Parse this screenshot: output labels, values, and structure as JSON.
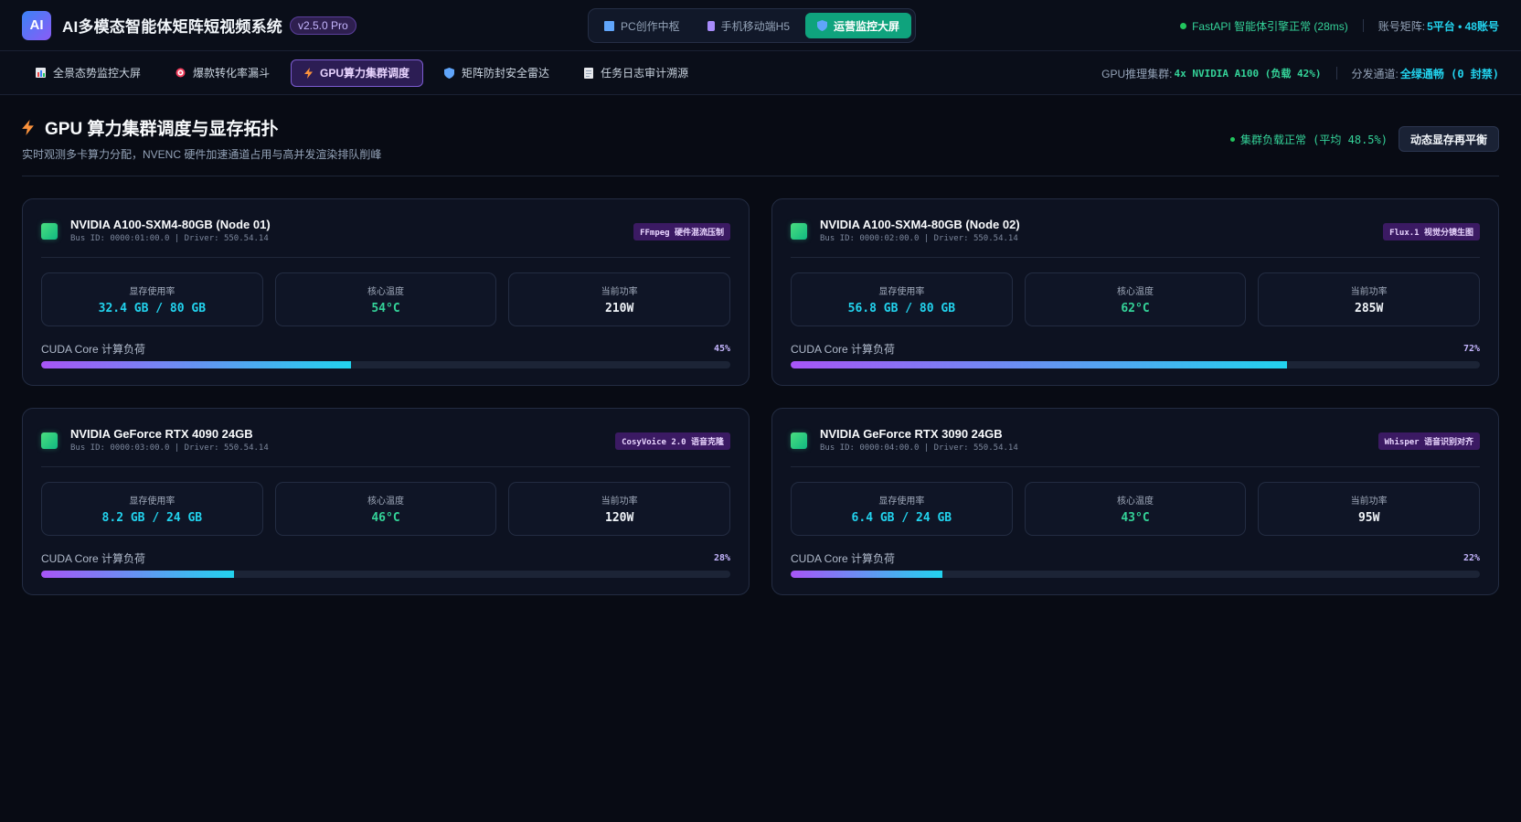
{
  "header": {
    "logo_text": "AI",
    "title": "AI多模态智能体矩阵短视频系统",
    "version": "v2.5.0 Pro",
    "modes": [
      {
        "label": "PC创作中枢",
        "icon": "monitor-icon"
      },
      {
        "label": "手机移动端H5",
        "icon": "phone-icon"
      },
      {
        "label": "运营监控大屏",
        "icon": "shield-icon",
        "active": true
      }
    ],
    "engine_status": "FastAPI 智能体引擎正常 (28ms)",
    "account_label": "账号矩阵:",
    "account_value": "5平台 • 48账号"
  },
  "subnav": {
    "tabs": [
      {
        "label": "全景态势监控大屏",
        "icon": "bar-chart-icon"
      },
      {
        "label": "爆款转化率漏斗",
        "icon": "target-icon"
      },
      {
        "label": "GPU算力集群调度",
        "icon": "lightning-icon",
        "active": true
      },
      {
        "label": "矩阵防封安全雷达",
        "icon": "shield-icon"
      },
      {
        "label": "任务日志审计溯源",
        "icon": "document-icon"
      }
    ],
    "gpu_label": "GPU推理集群:",
    "gpu_value": "4x NVIDIA A100 (负载 42%)",
    "dist_label": "分发通道:",
    "dist_value": "全绿通畅 (0 封禁)"
  },
  "page": {
    "title": "GPU 算力集群调度与显存拓扑",
    "subtitle": "实时观测多卡算力分配，NVENC 硬件加速通道占用与高并发渲染排队削峰",
    "cluster_status": "集群负载正常 (平均 48.5%)",
    "rebalance_label": "动态显存再平衡"
  },
  "labels": {
    "vram": "显存使用率",
    "temp": "核心温度",
    "power": "当前功率",
    "load": "CUDA Core 计算负荷"
  },
  "gpus": [
    {
      "name": "NVIDIA A100-SXM4-80GB (Node 01)",
      "bus": "Bus ID: 0000:01:00.0 | Driver: 550.54.14",
      "task": "FFmpeg 硬件混流压制",
      "vram": "32.4 GB / 80 GB",
      "temp": "54°C",
      "power": "210W",
      "load_text": "45%",
      "load": 45
    },
    {
      "name": "NVIDIA A100-SXM4-80GB (Node 02)",
      "bus": "Bus ID: 0000:02:00.0 | Driver: 550.54.14",
      "task": "Flux.1 视觉分镜生图",
      "vram": "56.8 GB / 80 GB",
      "temp": "62°C",
      "power": "285W",
      "load_text": "72%",
      "load": 72
    },
    {
      "name": "NVIDIA GeForce RTX 4090 24GB",
      "bus": "Bus ID: 0000:03:00.0 | Driver: 550.54.14",
      "task": "CosyVoice 2.0 语音克隆",
      "vram": "8.2 GB / 24 GB",
      "temp": "46°C",
      "power": "120W",
      "load_text": "28%",
      "load": 28
    },
    {
      "name": "NVIDIA GeForce RTX 3090 24GB",
      "bus": "Bus ID: 0000:04:00.0 | Driver: 550.54.14",
      "task": "Whisper 语音识别对齐",
      "vram": "6.4 GB / 24 GB",
      "temp": "43°C",
      "power": "95W",
      "load_text": "22%",
      "load": 22
    }
  ]
}
